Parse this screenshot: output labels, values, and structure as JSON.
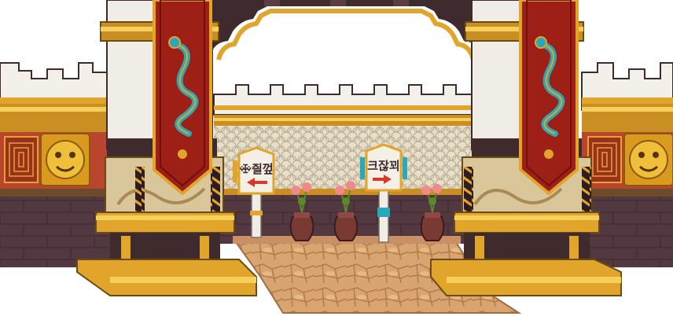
{
  "scene": {
    "signs": {
      "left": {
        "text": "ꗾ즬껖",
        "arrow": "left"
      },
      "right": {
        "text": "크잖꾀",
        "arrow": "right"
      }
    },
    "colors": {
      "banner": "#9e1f16",
      "banner_dark": "#6b120c",
      "gold": "#e0a52a",
      "gold_light": "#f4cf5a",
      "wall_white": "#f3f0ea",
      "wall_dark": "#3f2a2e",
      "brick": "#b8452c",
      "stone": "#d8a571",
      "dragon": "#2aa7b8",
      "arrow": "#d8382a",
      "vase": "#7a3a34",
      "flower": "#f08a8a",
      "leaf": "#5a8a2a"
    },
    "icons": [
      "dragon-icon",
      "lion-face-icon",
      "arrow-left-icon",
      "arrow-right-icon",
      "flower-icon"
    ]
  }
}
